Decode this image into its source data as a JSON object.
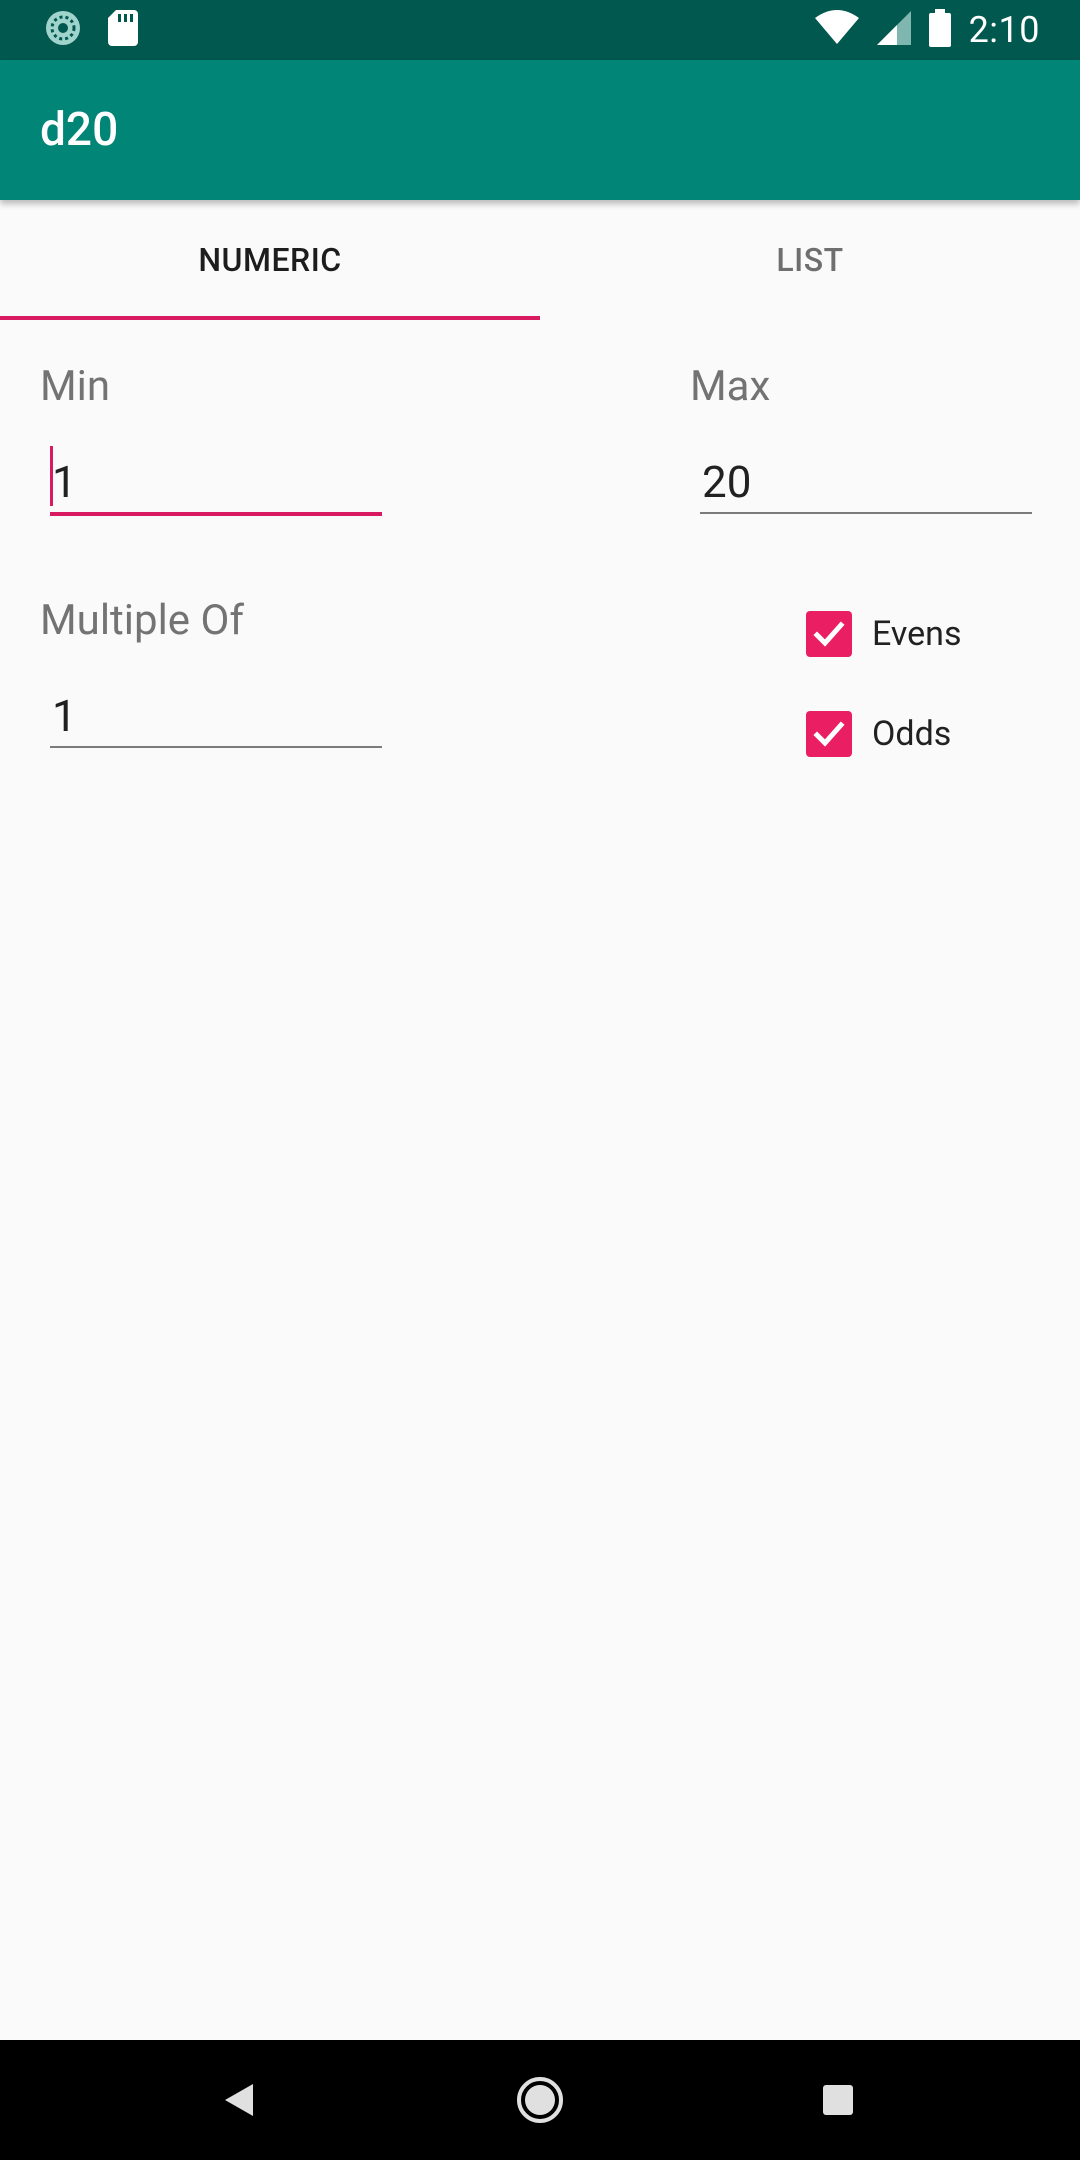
{
  "status_bar": {
    "time": "2:10",
    "left_icons": [
      "sync-icon",
      "sd-card-icon"
    ],
    "right_icons": [
      "wifi-icon",
      "signal-icon",
      "battery-icon"
    ]
  },
  "app_bar": {
    "title": "d20",
    "color": "#008577"
  },
  "tabs": {
    "items": [
      {
        "label": "NUMERIC",
        "active": true
      },
      {
        "label": "LIST",
        "active": false
      }
    ],
    "indicator_color": "#d81b60"
  },
  "form": {
    "min": {
      "label": "Min",
      "value": "1"
    },
    "max": {
      "label": "Max",
      "value": "20"
    },
    "multiple_of": {
      "label": "Multiple Of",
      "value": "1"
    },
    "evens": {
      "label": "Evens",
      "checked": true
    },
    "odds": {
      "label": "Odds",
      "checked": true
    },
    "accent_color": "#e91e63"
  },
  "nav_bar": {
    "buttons": [
      "back-icon",
      "home-icon",
      "recents-icon"
    ]
  }
}
